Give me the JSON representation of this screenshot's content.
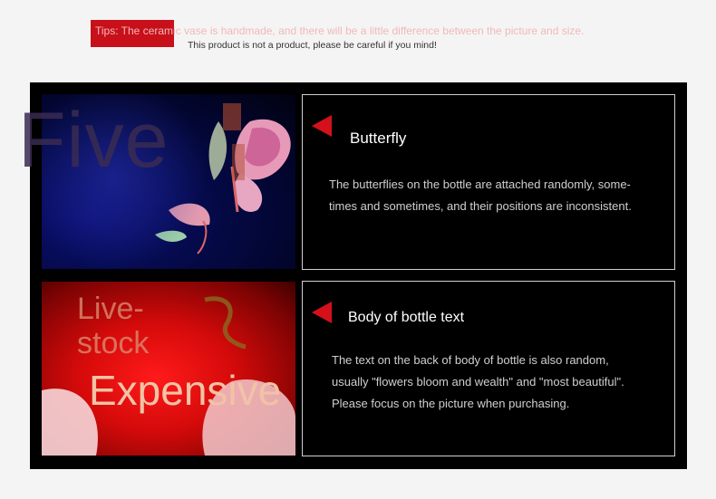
{
  "tips": {
    "label": "Tips: The ceramic vase is handmade, and there will be a little difference between the picture and size.",
    "note": "This product is not a product, please be careful if you mind!"
  },
  "images": {
    "top_overlay": "Five",
    "bottom_overlay_1": "Live-",
    "bottom_overlay_2": "stock",
    "bottom_overlay_3": "Expensive"
  },
  "panels": [
    {
      "title": "Butterfly",
      "body": "The butterflies on the bottle are attached randomly, some-times and sometimes, and their positions are inconsistent."
    },
    {
      "title": "Body of bottle text",
      "body": "The text on the back of body of bottle is also random, usually \"flowers bloom and wealth\" and \"most beautiful\". Please focus on the picture when purchasing."
    }
  ],
  "colors": {
    "accent": "#d4111b",
    "frame": "#000000",
    "page": "#f4f4f4"
  }
}
